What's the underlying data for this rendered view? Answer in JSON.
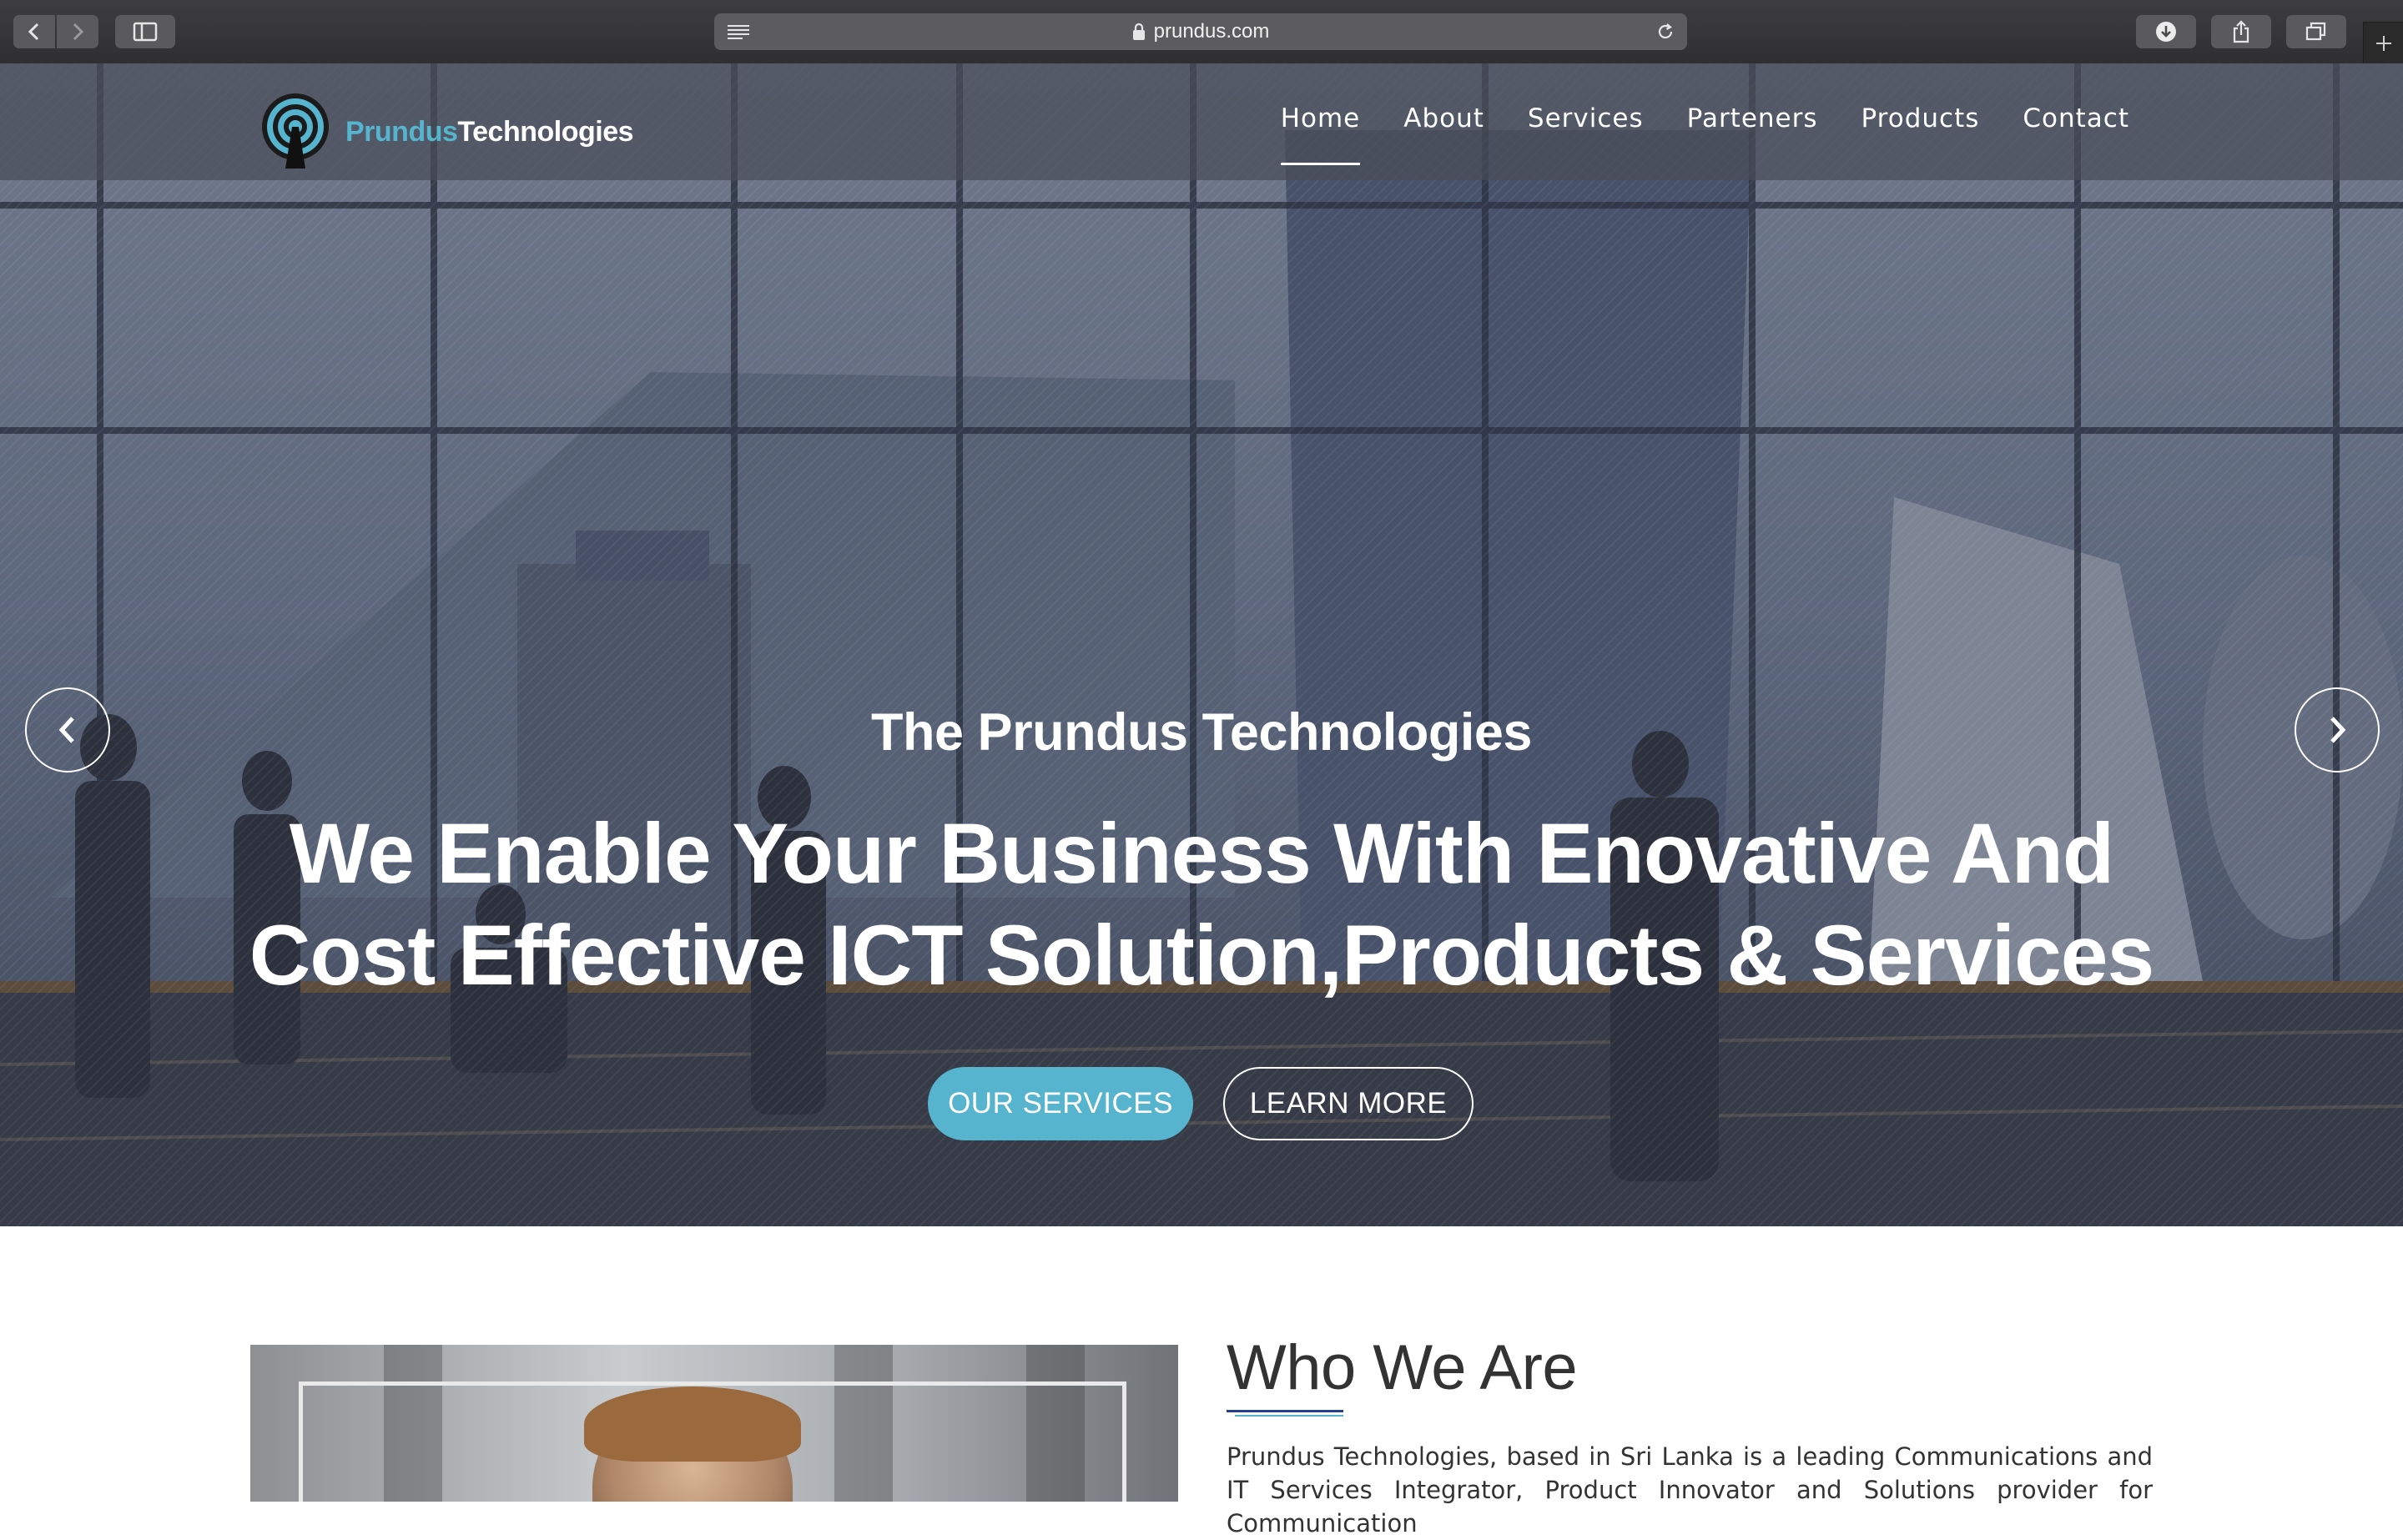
{
  "browser": {
    "url": "prundus.com",
    "icons": {
      "back": "chevron-left-icon",
      "forward": "chevron-right-icon",
      "sidebar": "sidebar-icon",
      "reader": "reader-icon",
      "lock": "lock-icon",
      "reload": "reload-icon",
      "download": "download-icon",
      "share": "share-icon",
      "tabs": "tabs-icon",
      "new_tab": "plus-icon"
    }
  },
  "site": {
    "logo": {
      "part1": "Prundus",
      "part2": "Technologies"
    },
    "nav": [
      {
        "label": "Home",
        "active": true
      },
      {
        "label": "About",
        "active": false
      },
      {
        "label": "Services",
        "active": false
      },
      {
        "label": "Parteners",
        "active": false
      },
      {
        "label": "Products",
        "active": false
      },
      {
        "label": "Contact",
        "active": false
      }
    ],
    "hero": {
      "subtitle": "The Prundus Technologies",
      "title": "We Enable Your Business With Enovative And Cost Effective ICT Solution,Products & Services",
      "primary_button": "OUR SERVICES",
      "secondary_button": "LEARN MORE",
      "slides_count": 3,
      "active_slide": 2
    },
    "about": {
      "title": "Who We Are",
      "text": "Prundus Technologies, based in Sri Lanka is a leading Communications and IT Services Integrator, Product Innovator and Solutions provider for Communication"
    }
  },
  "colors": {
    "accent": "#56b4cf",
    "accent_dark": "#27408b",
    "chrome_bg": "#3a3a3c",
    "text_dark": "#333333"
  }
}
